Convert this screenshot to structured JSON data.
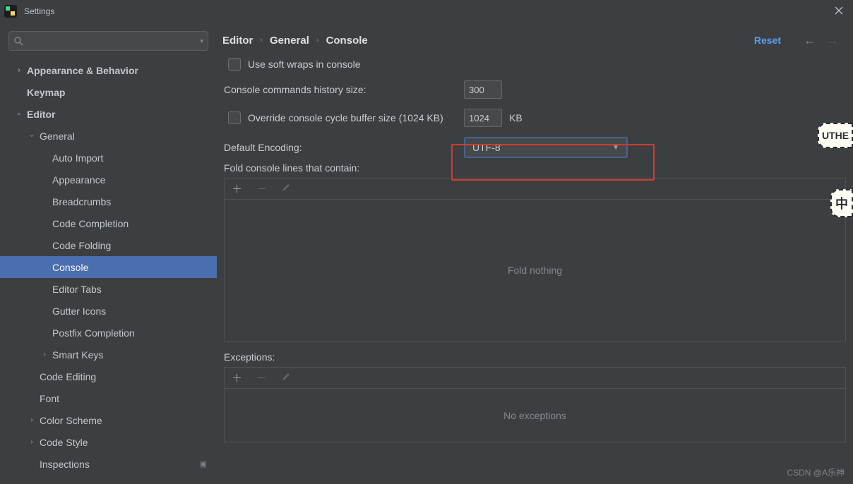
{
  "titlebar": {
    "title": "Settings"
  },
  "breadcrumb": {
    "a": "Editor",
    "b": "General",
    "c": "Console",
    "reset": "Reset"
  },
  "sidebar": {
    "items": [
      {
        "label": "Appearance & Behavior"
      },
      {
        "label": "Keymap"
      },
      {
        "label": "Editor"
      },
      {
        "label": "General"
      },
      {
        "label": "Auto Import"
      },
      {
        "label": "Appearance"
      },
      {
        "label": "Breadcrumbs"
      },
      {
        "label": "Code Completion"
      },
      {
        "label": "Code Folding"
      },
      {
        "label": "Console"
      },
      {
        "label": "Editor Tabs"
      },
      {
        "label": "Gutter Icons"
      },
      {
        "label": "Postfix Completion"
      },
      {
        "label": "Smart Keys"
      },
      {
        "label": "Code Editing"
      },
      {
        "label": "Font"
      },
      {
        "label": "Color Scheme"
      },
      {
        "label": "Code Style"
      },
      {
        "label": "Inspections"
      }
    ]
  },
  "form": {
    "soft_wraps_label": "Use soft wraps in console",
    "history_label": "Console commands history size:",
    "history_value": "300",
    "override_label": "Override console cycle buffer size (1024 KB)",
    "override_value": "1024",
    "override_unit": "KB",
    "encoding_label": "Default Encoding:",
    "encoding_value": "UTF-8",
    "fold_label": "Fold console lines that contain:",
    "fold_empty": "Fold nothing",
    "exceptions_label": "Exceptions:",
    "exceptions_empty": "No exceptions"
  },
  "watermark": "CSDN @A乐神",
  "stickers": {
    "s1": "UTHE",
    "s2": "中"
  }
}
